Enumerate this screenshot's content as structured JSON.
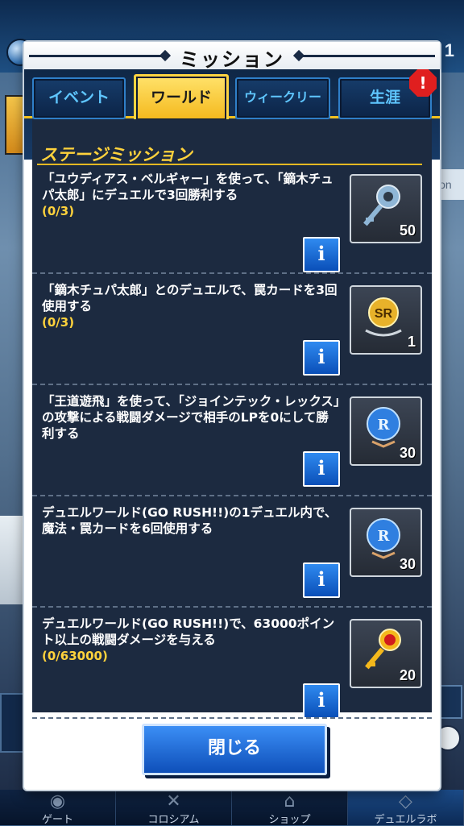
{
  "background": {
    "top_right_number": "1",
    "side_text": "ion"
  },
  "bottom_nav": [
    {
      "label": "ゲート",
      "icon": "gate-icon"
    },
    {
      "label": "コロシアム",
      "icon": "colosseum-icon"
    },
    {
      "label": "ショップ",
      "icon": "shop-icon"
    },
    {
      "label": "デュエルラボ",
      "icon": "lab-icon"
    }
  ],
  "modal": {
    "title": "ミッション",
    "tabs": [
      {
        "label": "イベント",
        "active": false
      },
      {
        "label": "ワールド",
        "active": true
      },
      {
        "label": "ウィークリー",
        "active": false
      },
      {
        "label": "生涯",
        "active": false
      }
    ],
    "alert_badge": "!",
    "section_title": "ステージミッション",
    "missions": [
      {
        "text": "「ユウディアス・ベルギャー」を使って、「鏑木チュパ太郎」にデュエルで3回勝利する",
        "progress": "(0/3)",
        "reward_icon": "key-icon",
        "reward_count": "50"
      },
      {
        "text": "「鏑木チュパ太郎」とのデュエルで、罠カードを3回使用する",
        "progress": "(0/3)",
        "reward_icon": "sr-ticket-icon",
        "reward_count": "1"
      },
      {
        "text": "「王道遊飛」を使って、「ジョインテック・レックス」の攻撃による戦闘ダメージで相手のLPを0にして勝利する",
        "progress": "",
        "reward_icon": "r-orb-icon",
        "reward_count": "30"
      },
      {
        "text": "デュエルワールド(GO RUSH!!)の1デュエル内で、魔法・罠カードを6回使用する",
        "progress": "",
        "reward_icon": "r-orb-icon",
        "reward_count": "30"
      },
      {
        "text": "デュエルワールド(GO RUSH!!)で、63000ポイント以上の戦闘ダメージを与える",
        "progress": "(0/63000)",
        "reward_icon": "red-key-icon",
        "reward_count": "20"
      }
    ],
    "info_label": "i",
    "close_label": "閉じる"
  }
}
